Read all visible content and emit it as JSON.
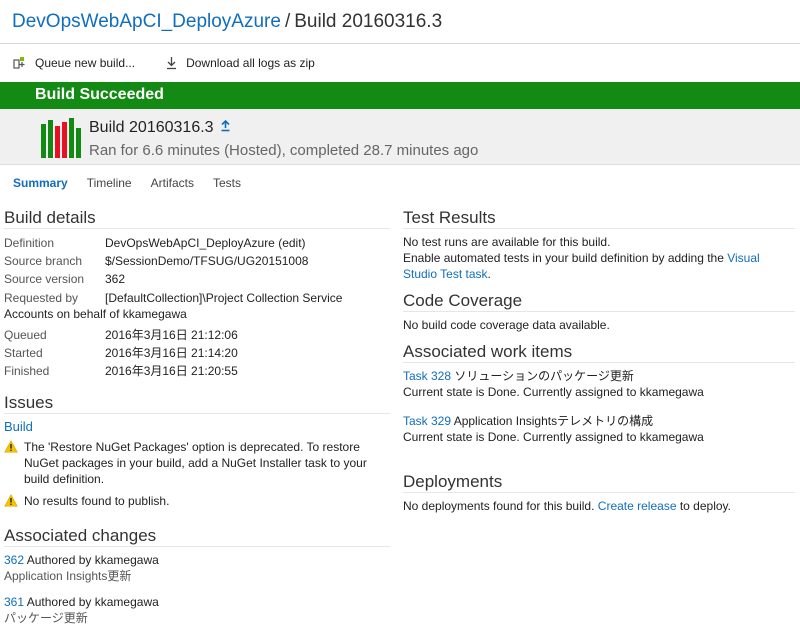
{
  "header": {
    "definition_link": "DevOpsWebApCI_DeployAzure",
    "separator": "/",
    "title": "Build 20160316.3"
  },
  "toolbar": {
    "queue_label": "Queue new build...",
    "download_label": "Download all logs as zip"
  },
  "banner": {
    "status": "Build Succeeded",
    "color": "#138a13"
  },
  "summary": {
    "build_name": "Build 20160316.3",
    "ran_text": "Ran for 6.6 minutes (Hosted), completed 28.7 minutes ago"
  },
  "tabs": [
    {
      "label": "Summary"
    },
    {
      "label": "Timeline"
    },
    {
      "label": "Artifacts"
    },
    {
      "label": "Tests"
    }
  ],
  "build_details": {
    "title": "Build details",
    "definition_label": "Definition",
    "definition_value": "DevOpsWebApCI_DeployAzure (edit)",
    "branch_label": "Source branch",
    "branch_value": "$/SessionDemo/TFSUG/UG20151008",
    "version_label": "Source version",
    "version_value": "362",
    "requested_label": "Requested by",
    "requested_value": "[DefaultCollection]\\Project Collection Service",
    "requested_cont": "Accounts on behalf of kkamegawa",
    "queued_label": "Queued",
    "queued_value": "2016年3月16日 21:12:06",
    "started_label": "Started",
    "started_value": "2016年3月16日 21:14:20",
    "finished_label": "Finished",
    "finished_value": "2016年3月16日 21:20:55"
  },
  "issues": {
    "title": "Issues",
    "group": "Build",
    "items": [
      "The 'Restore NuGet Packages' option is deprecated. To restore NuGet packages in your build, add a NuGet Installer task to your build definition.",
      "No results found to publish."
    ]
  },
  "changes": {
    "title": "Associated changes",
    "items": [
      {
        "id": "362",
        "author": " Authored by kkamegawa",
        "message": "Application Insights更新"
      },
      {
        "id": "361",
        "author": " Authored by kkamegawa",
        "message": "パッケージ更新"
      }
    ]
  },
  "test_results": {
    "title": "Test Results",
    "line1": "No test runs are available for this build.",
    "line2_pre": "Enable automated tests in your build definition by adding the ",
    "line2_link": "Visual Studio Test task",
    "line2_post": "."
  },
  "code_coverage": {
    "title": "Code Coverage",
    "text": "No build code coverage data available."
  },
  "work_items": {
    "title": "Associated work items",
    "items": [
      {
        "id": "Task 328",
        "name": " ソリューションのパッケージ更新",
        "state": "Current state is Done. Currently assigned to kkamegawa"
      },
      {
        "id": "Task 329",
        "name": " Application Insightsテレメトリの構成",
        "state": "Current state is Done. Currently assigned to kkamegawa"
      }
    ]
  },
  "deployments": {
    "title": "Deployments",
    "pre": "No deployments found for this build. ",
    "link": "Create release",
    "post": " to deploy."
  },
  "icons": {
    "queue": "queue-build-icon",
    "download": "download-icon",
    "pin": "pin-icon",
    "warning": "warning-icon",
    "history": "build-history-bars-icon"
  }
}
